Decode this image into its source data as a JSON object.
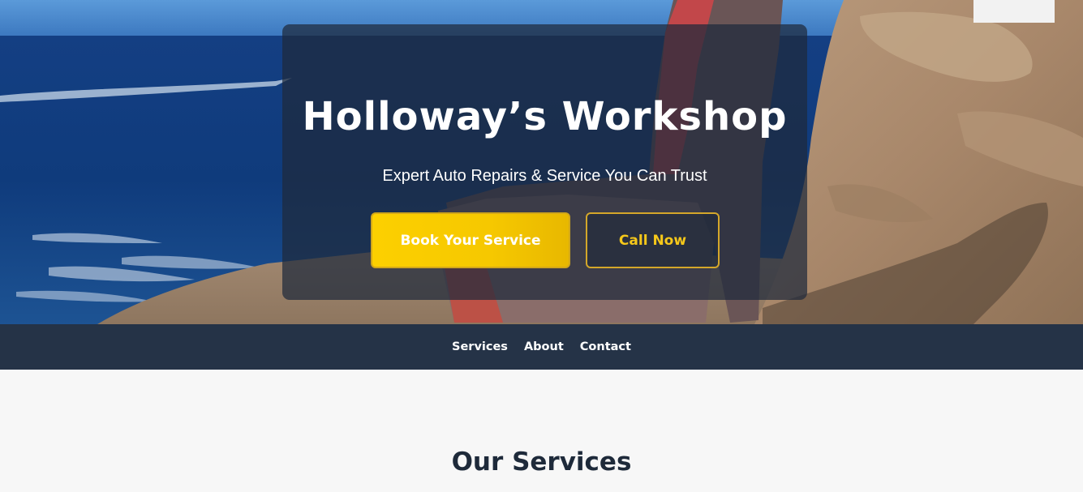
{
  "hero": {
    "title": "Holloway’s Workshop",
    "subtitle": "Expert Auto Repairs & Service You Can Trust",
    "primary_button": "Book Your Service",
    "secondary_button": "Call Now",
    "background_image": "armchair-on-seaside-rocks"
  },
  "nav": {
    "links": [
      "Services",
      "About",
      "Contact"
    ]
  },
  "services": {
    "title": "Our Services"
  },
  "colors": {
    "accent": "#f6c800",
    "nav_bg": "#253347",
    "overlay": "#1e293b",
    "heading_text": "#1e2a3a",
    "page_bg": "#f7f7f7"
  }
}
